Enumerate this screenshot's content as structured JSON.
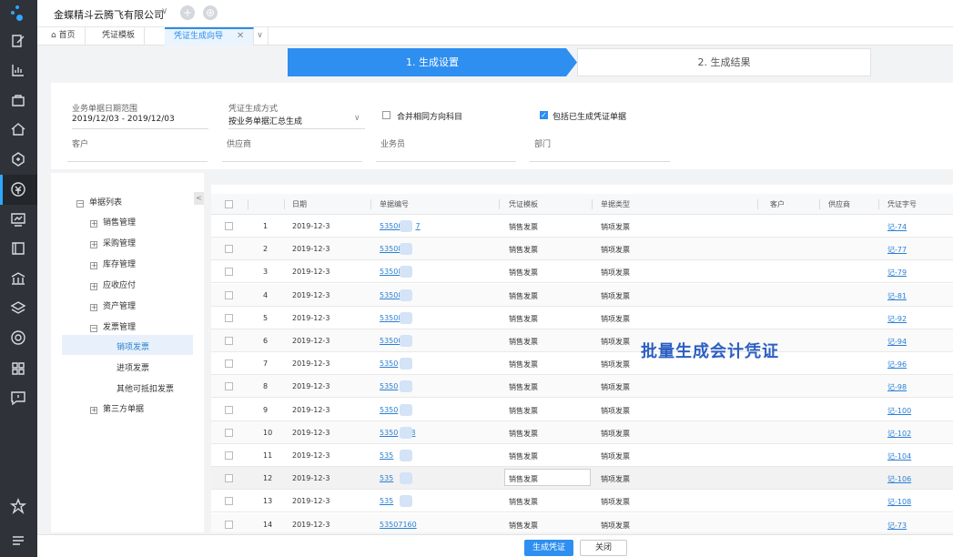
{
  "sidebar": {
    "icons": [
      "edit-icon",
      "report-icon",
      "bag-icon",
      "home-icon",
      "settings-hex-icon",
      "finance-icon",
      "monitor-chart-icon",
      "ledger-icon",
      "bank-icon",
      "layers-icon",
      "gear-icon",
      "apps-icon",
      "message-icon",
      "star-icon",
      "menu-icon"
    ],
    "active_color": "#2ea7ff"
  },
  "topbar": {
    "company": "金蝶精斗云腾飞有限公司",
    "chevron": "∨",
    "plus": "+",
    "more": "⊕"
  },
  "tabs": [
    {
      "label": "首页",
      "icon": "⌂"
    },
    {
      "label": "凭证模板"
    },
    {
      "label": "凭证生成向导",
      "close": "✕"
    }
  ],
  "tab_more": "∨",
  "steps": {
    "step1": "1. 生成设置",
    "step2": "2. 生成结果"
  },
  "form": {
    "date_range_label": "业务单据日期范围",
    "date_range_value": "2019/12/03 - 2019/12/03",
    "method_label": "凭证生成方式",
    "method_value": "按业务单据汇总生成",
    "merge_label": "合并相同方向科目",
    "merge_checked": false,
    "include_label": "包括已生成凭证单据",
    "include_checked": true,
    "customer_label": "客户",
    "supplier_label": "供应商",
    "salesman_label": "业务员",
    "department_label": "部门"
  },
  "tree": {
    "root": "单据列表",
    "items": [
      {
        "label": "销售管理",
        "expand": "+"
      },
      {
        "label": "采购管理",
        "expand": "+"
      },
      {
        "label": "库存管理",
        "expand": "+"
      },
      {
        "label": "应收应付",
        "expand": "+"
      },
      {
        "label": "资产管理",
        "expand": "+"
      },
      {
        "label": "发票管理",
        "expand": "−"
      }
    ],
    "children": [
      "销项发票",
      "进项发票",
      "其他可抵扣发票"
    ],
    "last": {
      "label": "第三方单据",
      "expand": "+"
    },
    "collapse": "<"
  },
  "grid": {
    "headers": [
      "日期",
      "单据编号",
      "凭证模板",
      "单据类型",
      "客户",
      "供应商",
      "凭证字号"
    ],
    "rows": [
      {
        "no": "1",
        "date": "2019-12-3",
        "code_pre": "53500",
        "code_suf": "7",
        "template": "销售发票",
        "type": "销项发票",
        "voucher": "记-74"
      },
      {
        "no": "2",
        "date": "2019-12-3",
        "code_pre": "53508",
        "code_suf": "",
        "template": "销售发票",
        "type": "销项发票",
        "voucher": "记-77"
      },
      {
        "no": "3",
        "date": "2019-12-3",
        "code_pre": "53508",
        "code_suf": "",
        "template": "销售发票",
        "type": "销项发票",
        "voucher": "记-79"
      },
      {
        "no": "4",
        "date": "2019-12-3",
        "code_pre": "53508",
        "code_suf": "",
        "template": "销售发票",
        "type": "销项发票",
        "voucher": "记-81"
      },
      {
        "no": "5",
        "date": "2019-12-3",
        "code_pre": "53508",
        "code_suf": "",
        "template": "销售发票",
        "type": "销项发票",
        "voucher": "记-92"
      },
      {
        "no": "6",
        "date": "2019-12-3",
        "code_pre": "53500",
        "code_suf": "",
        "template": "销售发票",
        "type": "销项发票",
        "voucher": "记-94"
      },
      {
        "no": "7",
        "date": "2019-12-3",
        "code_pre": "5350",
        "code_suf": "",
        "template": "销售发票",
        "type": "销项发票",
        "voucher": "记-96"
      },
      {
        "no": "8",
        "date": "2019-12-3",
        "code_pre": "5350",
        "code_suf": "",
        "template": "销售发票",
        "type": "销项发票",
        "voucher": "记-98"
      },
      {
        "no": "9",
        "date": "2019-12-3",
        "code_pre": "5350",
        "code_suf": "",
        "template": "销售发票",
        "type": "销项发票",
        "voucher": "记-100"
      },
      {
        "no": "10",
        "date": "2019-12-3",
        "code_pre": "5350",
        "code_suf": "8",
        "template": "销售发票",
        "type": "销项发票",
        "voucher": "记-102"
      },
      {
        "no": "11",
        "date": "2019-12-3",
        "code_pre": "535",
        "code_suf": "7",
        "template": "销售发票",
        "type": "销项发票",
        "voucher": "记-104"
      },
      {
        "no": "12",
        "date": "2019-12-3",
        "code_pre": "535",
        "code_suf": "6",
        "template": "销售发票",
        "type": "销项发票",
        "voucher": "记-106"
      },
      {
        "no": "13",
        "date": "2019-12-3",
        "code_pre": "535",
        "code_suf": "5",
        "template": "销售发票",
        "type": "销项发票",
        "voucher": "记-108"
      },
      {
        "no": "14",
        "date": "2019-12-3",
        "code_pre": "53507160",
        "code_suf": "",
        "template": "销售发票",
        "type": "销项发票",
        "voucher": "记-73"
      }
    ]
  },
  "watermark": "批量生成会计凭证",
  "buttons": {
    "generate": "生成凭证",
    "close": "关闭"
  }
}
